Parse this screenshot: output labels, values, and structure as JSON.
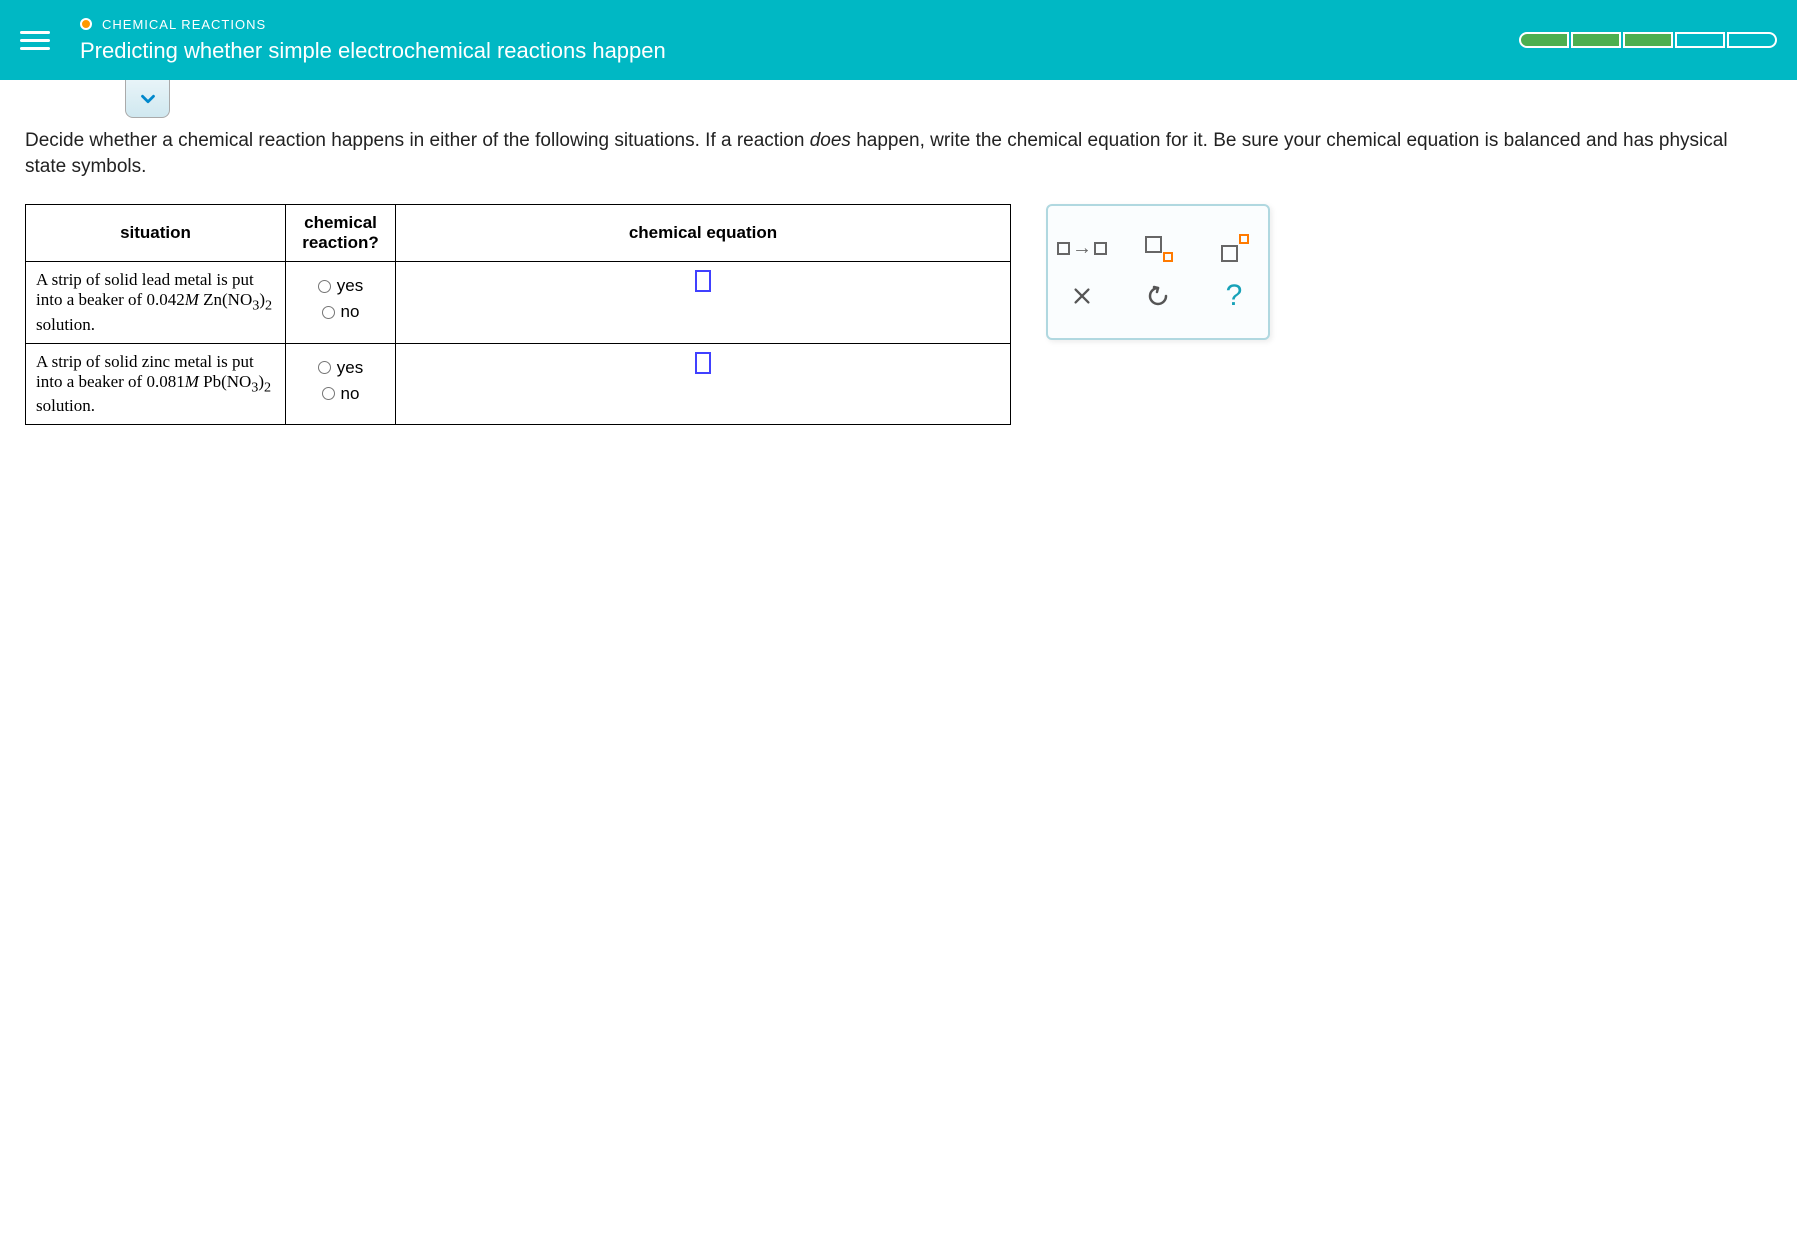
{
  "header": {
    "category": "CHEMICAL REACTIONS",
    "title": "Predicting whether simple electrochemical reactions happen",
    "progress_segments": [
      "filled",
      "filled",
      "filled",
      "empty",
      "empty"
    ]
  },
  "instructions": {
    "pre": "Decide whether a chemical reaction happens in either of the following situations. If a reaction ",
    "em": "does",
    "post": " happen, write the chemical equation for it. Be sure your chemical equation is balanced and has physical state symbols."
  },
  "table": {
    "headers": {
      "situation": "situation",
      "reaction": "chemical reaction?",
      "equation": "chemical equation"
    },
    "radio_labels": {
      "yes": "yes",
      "no": "no"
    },
    "rows": [
      {
        "situation_lead": "A strip of solid lead metal is put into a beaker of ",
        "situation_conc": "0.042",
        "situation_unit": "M",
        "situation_formula_base": "Zn(NO",
        "situation_formula_sub1": "3",
        "situation_formula_close": ")",
        "situation_formula_sub2": "2",
        "situation_tail": " solution."
      },
      {
        "situation_lead": "A strip of solid zinc metal is put into a beaker of ",
        "situation_conc": "0.081",
        "situation_unit": "M",
        "situation_formula_base": "Pb(NO",
        "situation_formula_sub1": "3",
        "situation_formula_close": ")",
        "situation_formula_sub2": "2",
        "situation_tail": " solution."
      }
    ]
  },
  "tools": {
    "arrow_icon": "arrow-reaction",
    "subscript_icon": "subscript",
    "superscript_icon": "superscript",
    "clear": "×",
    "reset": "↺",
    "help": "?"
  }
}
